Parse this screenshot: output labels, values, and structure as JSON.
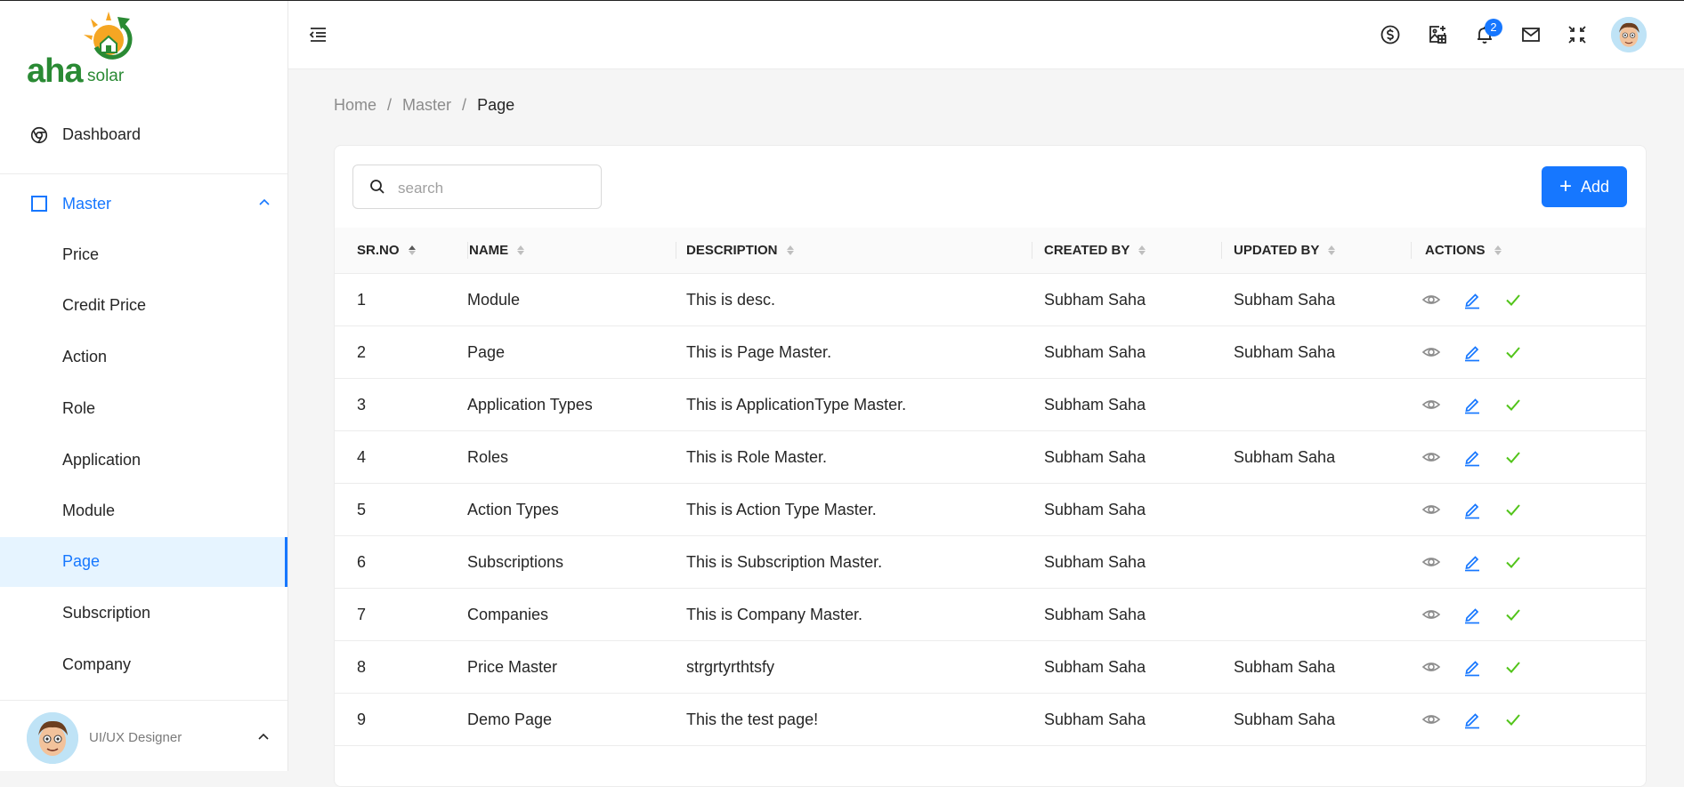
{
  "brand": {
    "name": "aha",
    "sub": "solar"
  },
  "sidebar": {
    "dashboard_label": "Dashboard",
    "master_label": "Master",
    "items": [
      {
        "label": "Price"
      },
      {
        "label": "Credit Price"
      },
      {
        "label": "Action"
      },
      {
        "label": "Role"
      },
      {
        "label": "Application"
      },
      {
        "label": "Module"
      },
      {
        "label": "Page",
        "active": true
      },
      {
        "label": "Subscription"
      },
      {
        "label": "Company"
      }
    ],
    "user_role": "UI/UX Designer"
  },
  "header": {
    "icons": [
      "menu-toggle-icon",
      "dollar-icon",
      "image-add-icon",
      "bell-icon",
      "mail-icon",
      "fullscreen-icon"
    ],
    "notification_count": "2"
  },
  "breadcrumb": {
    "home": "Home",
    "master": "Master",
    "current": "Page"
  },
  "toolbar": {
    "search_placeholder": "search",
    "add_label": "Add"
  },
  "table": {
    "columns": [
      "SR.NO",
      "NAME",
      "DESCRIPTION",
      "CREATED BY",
      "UPDATED BY",
      "ACTIONS"
    ],
    "rows": [
      {
        "sr": "1",
        "name": "Module",
        "description": "This is desc.",
        "created_by": "Subham Saha",
        "updated_by": "Subham Saha"
      },
      {
        "sr": "2",
        "name": "Page",
        "description": "This is Page Master.",
        "created_by": "Subham Saha",
        "updated_by": "Subham Saha"
      },
      {
        "sr": "3",
        "name": "Application Types",
        "description": "This is ApplicationType Master.",
        "created_by": "Subham Saha",
        "updated_by": ""
      },
      {
        "sr": "4",
        "name": "Roles",
        "description": "This is Role Master.",
        "created_by": "Subham Saha",
        "updated_by": "Subham Saha"
      },
      {
        "sr": "5",
        "name": "Action Types",
        "description": "This is Action Type Master.",
        "created_by": "Subham Saha",
        "updated_by": ""
      },
      {
        "sr": "6",
        "name": "Subscriptions",
        "description": "This is Subscription Master.",
        "created_by": "Subham Saha",
        "updated_by": ""
      },
      {
        "sr": "7",
        "name": "Companies",
        "description": "This is Company Master.",
        "created_by": "Subham Saha",
        "updated_by": ""
      },
      {
        "sr": "8",
        "name": "Price Master",
        "description": "strgrtyrthtsfy",
        "created_by": "Subham Saha",
        "updated_by": "Subham Saha"
      },
      {
        "sr": "9",
        "name": "Demo Page",
        "description": "This the test page!",
        "created_by": "Subham Saha",
        "updated_by": "Subham Saha"
      }
    ]
  },
  "colors": {
    "accent": "#1677ff",
    "brand_green": "#2a8a34",
    "active_bg": "#e6f4ff",
    "check_green": "#52c41a"
  }
}
